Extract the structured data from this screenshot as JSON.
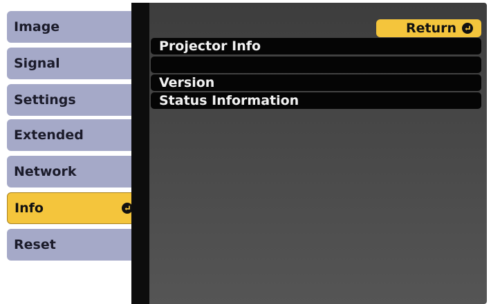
{
  "sidebar": {
    "items": [
      {
        "label": "Image"
      },
      {
        "label": "Signal"
      },
      {
        "label": "Settings"
      },
      {
        "label": "Extended"
      },
      {
        "label": "Network"
      },
      {
        "label": "Info",
        "active": true
      },
      {
        "label": "Reset"
      }
    ]
  },
  "main": {
    "return_label": "Return",
    "rows": [
      {
        "label": "Projector Info"
      },
      {
        "label": ""
      },
      {
        "label": "Version"
      },
      {
        "label": "Status Information"
      }
    ]
  },
  "colors": {
    "accent": "#f4c53c",
    "tab_inactive": "#a5a9c8",
    "panel": "#4a4a4a",
    "row": "#050505"
  },
  "icons": {
    "enter": "enter-icon"
  }
}
